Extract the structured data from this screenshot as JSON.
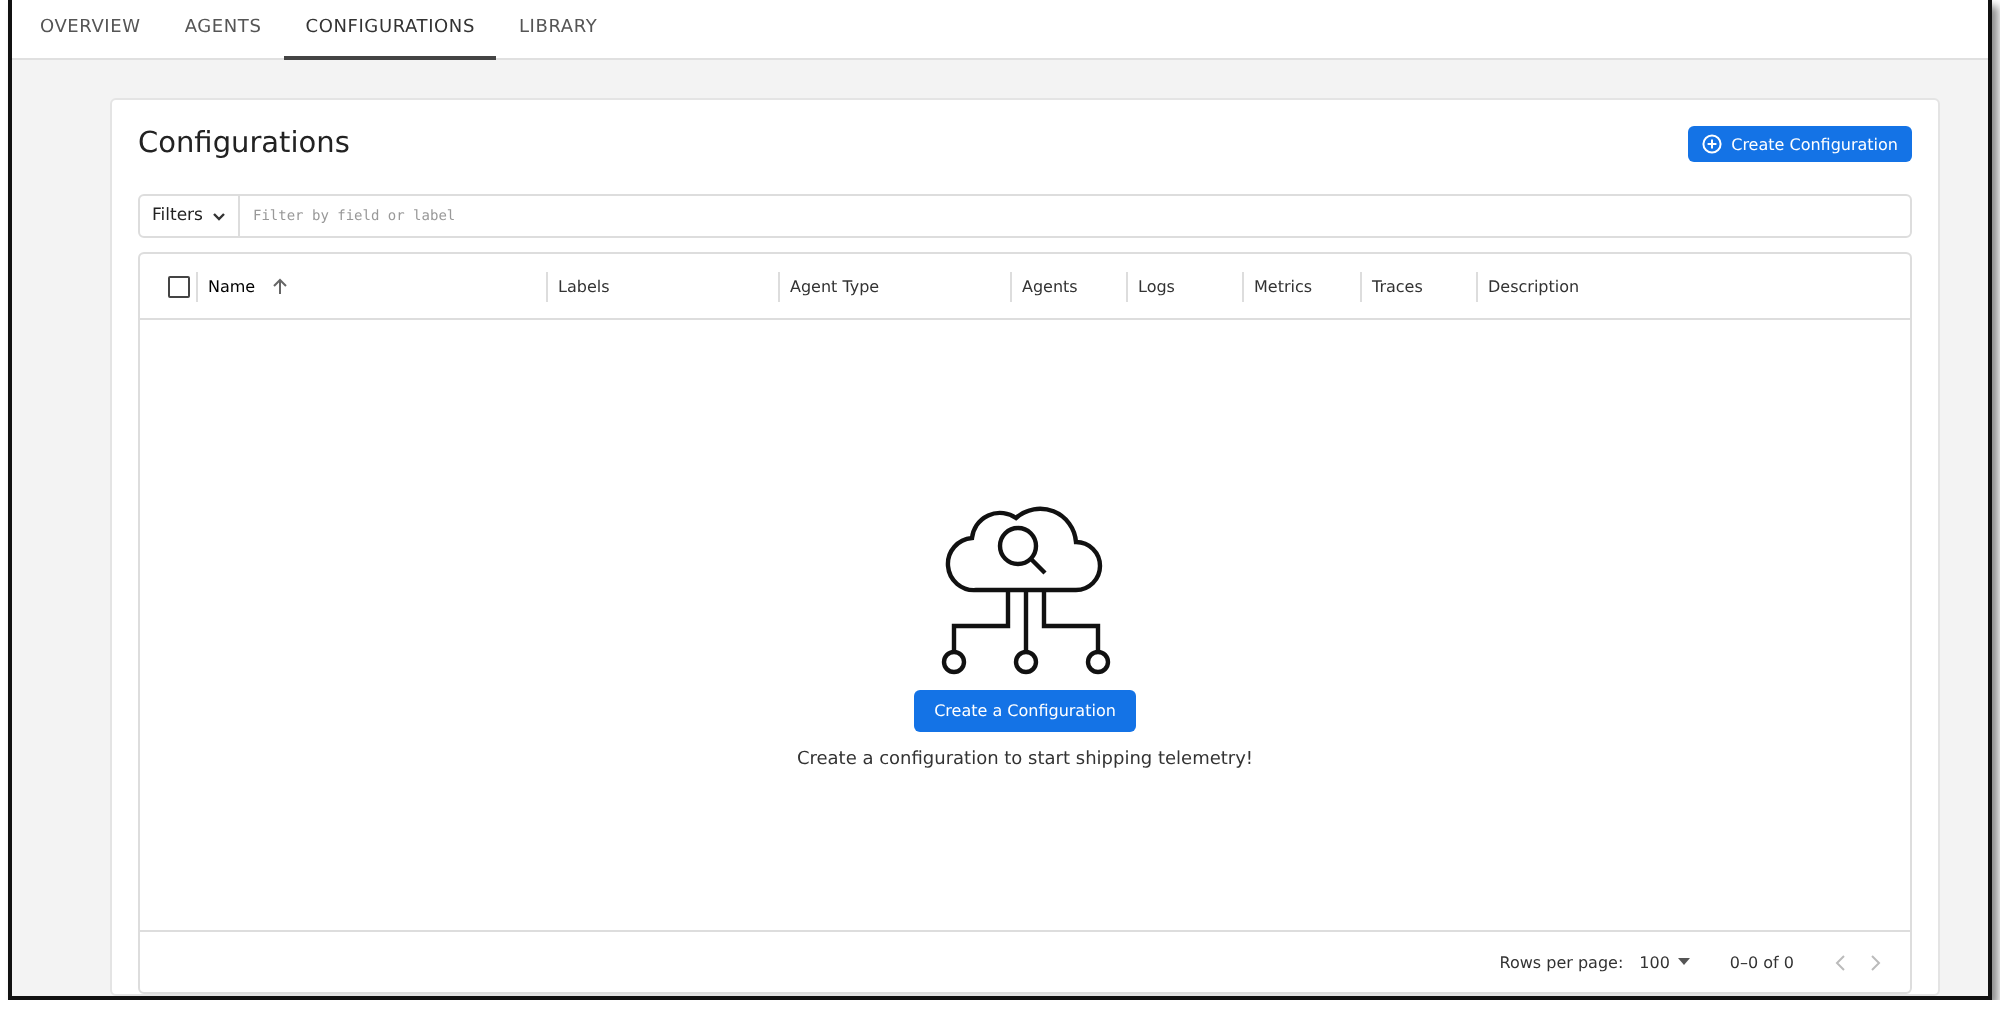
{
  "tabs": [
    {
      "label": "OVERVIEW",
      "selected": false
    },
    {
      "label": "AGENTS",
      "selected": false
    },
    {
      "label": "CONFIGURATIONS",
      "selected": true
    },
    {
      "label": "LIBRARY",
      "selected": false
    }
  ],
  "page": {
    "title": "Configurations",
    "create_button": "Create Configuration"
  },
  "filter": {
    "button": "Filters",
    "placeholder": "Filter by field or label"
  },
  "table": {
    "select_all": {
      "checked": false
    },
    "columns": [
      {
        "label": "Name",
        "sorted": true
      },
      {
        "label": "Labels",
        "sorted": false
      },
      {
        "label": "Agent Type",
        "sorted": false
      },
      {
        "label": "Agents",
        "sorted": false
      },
      {
        "label": "Logs",
        "sorted": false
      },
      {
        "label": "Metrics",
        "sorted": false
      },
      {
        "label": "Traces",
        "sorted": false
      },
      {
        "label": "Description",
        "sorted": false
      }
    ],
    "empty_state": {
      "button": "Create a Configuration",
      "message": "Create a configuration to start shipping telemetry!"
    },
    "footer": {
      "rows_per_page_label": "Rows per page:",
      "rows_per_page": "100",
      "range": "0–0 of 0"
    }
  }
}
